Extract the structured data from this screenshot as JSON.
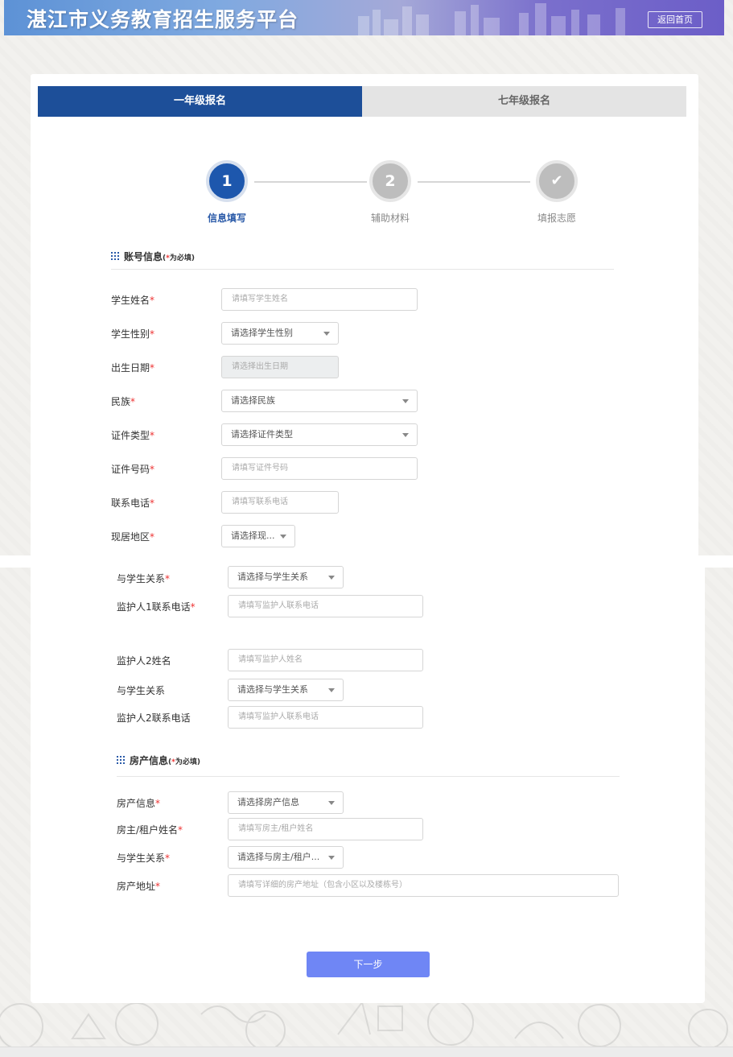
{
  "header": {
    "title": "湛江市义务教育招生服务平台",
    "home_button": "返回首页"
  },
  "tabs": [
    {
      "label": "一年级报名",
      "active": true
    },
    {
      "label": "七年级报名",
      "active": false
    }
  ],
  "steps": [
    {
      "number": "1",
      "label": "信息填写",
      "state": "active"
    },
    {
      "number": "2",
      "label": "辅助材料",
      "state": "pending"
    },
    {
      "number": "✔",
      "label": "填报志愿",
      "state": "pending"
    }
  ],
  "account_section": {
    "title": "账号信息",
    "required_note_prefix": "(",
    "required_note_star": "*",
    "required_note_text": "为必填)",
    "fields": [
      {
        "label": "学生姓名",
        "required": true,
        "type": "input",
        "placeholder": "请填写学生姓名"
      },
      {
        "label": "学生性别",
        "required": true,
        "type": "select",
        "value": "请选择学生性别"
      },
      {
        "label": "出生日期",
        "required": true,
        "type": "date",
        "placeholder": "请选择出生日期"
      },
      {
        "label": "民族",
        "required": true,
        "type": "select",
        "value": "请选择民族"
      },
      {
        "label": "证件类型",
        "required": true,
        "type": "select",
        "value": "请选择证件类型"
      },
      {
        "label": "证件号码",
        "required": true,
        "type": "input",
        "placeholder": "请填写证件号码"
      },
      {
        "label": "联系电话",
        "required": true,
        "type": "input",
        "placeholder": "请填写联系电话"
      },
      {
        "label": "现居地区",
        "required": true,
        "type": "select",
        "value": "请选择现..."
      }
    ]
  },
  "guardian_fields": [
    {
      "label": "与学生关系",
      "required": true,
      "type": "select",
      "value": "请选择与学生关系"
    },
    {
      "label": "监护人1联系电话",
      "required": true,
      "type": "input",
      "placeholder": "请填写监护人联系电话"
    },
    {
      "label": "监护人2姓名",
      "required": false,
      "type": "input",
      "placeholder": "请填写监护人姓名"
    },
    {
      "label": "与学生关系",
      "required": false,
      "type": "select",
      "value": "请选择与学生关系"
    },
    {
      "label": "监护人2联系电话",
      "required": false,
      "type": "input",
      "placeholder": "请填写监护人联系电话"
    }
  ],
  "property_section": {
    "title": "房产信息",
    "required_note_prefix": "(",
    "required_note_star": "*",
    "required_note_text": "为必填)",
    "fields": [
      {
        "label": "房产信息",
        "required": true,
        "type": "select",
        "value": "请选择房产信息"
      },
      {
        "label": "房主/租户姓名",
        "required": true,
        "type": "input",
        "placeholder": "请填写房主/租户姓名"
      },
      {
        "label": "与学生关系",
        "required": true,
        "type": "select",
        "value": "请选择与房主/租户..."
      },
      {
        "label": "房产地址",
        "required": true,
        "type": "input",
        "placeholder": "请填写详细的房产地址（包含小区以及楼栋号）"
      }
    ]
  },
  "next_button": "下一步",
  "colors": {
    "primary": "#1d4f99",
    "step_active": "#1d57ad",
    "required_star": "#e33333",
    "next_button": "#6f86f5"
  }
}
